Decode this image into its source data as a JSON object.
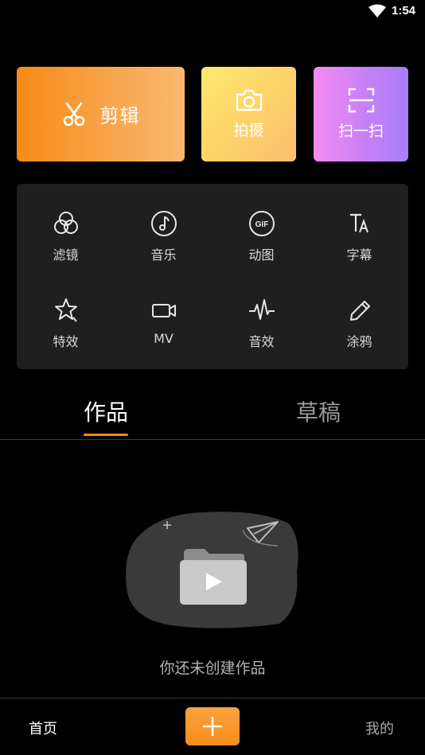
{
  "status_bar": {
    "time": "1:54"
  },
  "top_actions": {
    "edit_label": "剪辑",
    "shoot_label": "拍摄",
    "scan_label": "扫一扫"
  },
  "tools": [
    {
      "label": "滤镜",
      "icon": "filter-icon"
    },
    {
      "label": "音乐",
      "icon": "music-icon"
    },
    {
      "label": "动图",
      "icon": "gif-icon"
    },
    {
      "label": "字幕",
      "icon": "subtitle-icon"
    },
    {
      "label": "特效",
      "icon": "effects-icon"
    },
    {
      "label": "MV",
      "icon": "mv-camera-icon"
    },
    {
      "label": "音效",
      "icon": "sound-wave-icon"
    },
    {
      "label": "涂鸦",
      "icon": "pencil-icon"
    }
  ],
  "tabs": [
    {
      "label": "作品",
      "active": true
    },
    {
      "label": "草稿",
      "active": false
    }
  ],
  "empty_state": {
    "message": "你还未创建作品"
  },
  "bottom_nav": {
    "home_label": "首页",
    "mine_label": "我的"
  },
  "colors": {
    "accent": "#f7861a",
    "panel": "#1f1f1f",
    "background": "#000000"
  }
}
